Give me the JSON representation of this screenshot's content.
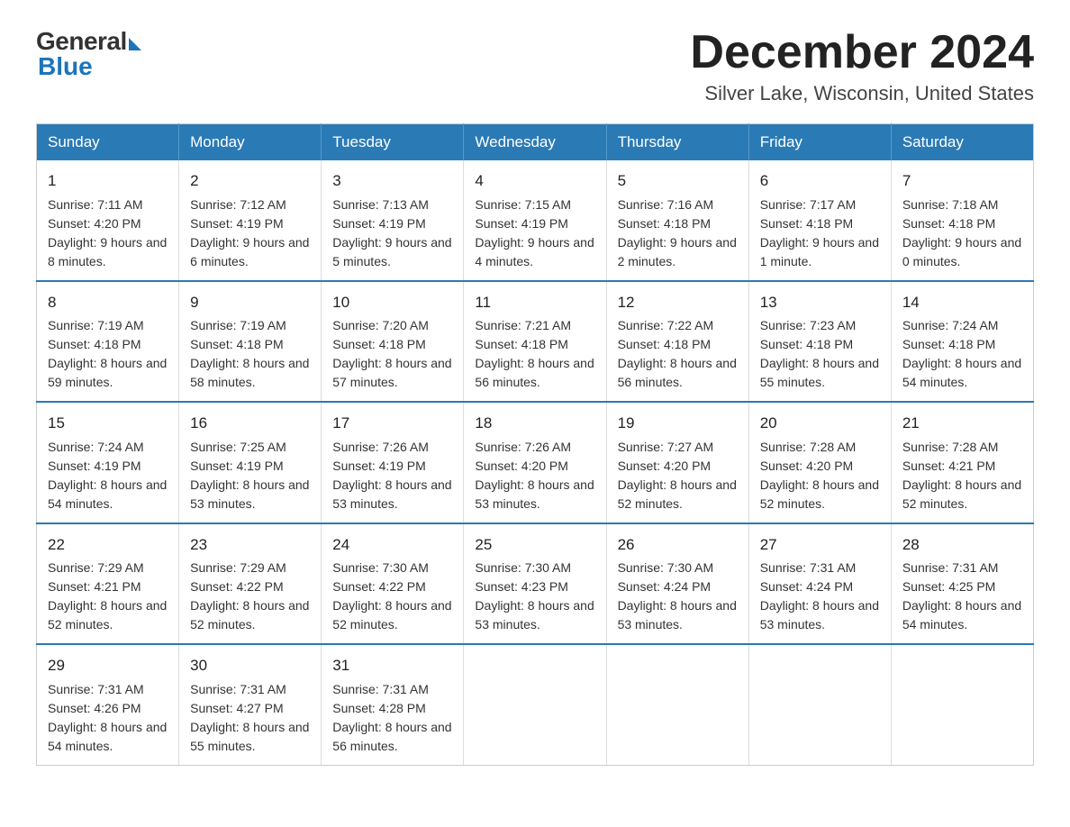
{
  "logo": {
    "general": "General",
    "blue": "Blue"
  },
  "header": {
    "month_year": "December 2024",
    "location": "Silver Lake, Wisconsin, United States"
  },
  "weekdays": [
    "Sunday",
    "Monday",
    "Tuesday",
    "Wednesday",
    "Thursday",
    "Friday",
    "Saturday"
  ],
  "weeks": [
    [
      {
        "day": "1",
        "sunrise": "7:11 AM",
        "sunset": "4:20 PM",
        "daylight": "9 hours and 8 minutes."
      },
      {
        "day": "2",
        "sunrise": "7:12 AM",
        "sunset": "4:19 PM",
        "daylight": "9 hours and 6 minutes."
      },
      {
        "day": "3",
        "sunrise": "7:13 AM",
        "sunset": "4:19 PM",
        "daylight": "9 hours and 5 minutes."
      },
      {
        "day": "4",
        "sunrise": "7:15 AM",
        "sunset": "4:19 PM",
        "daylight": "9 hours and 4 minutes."
      },
      {
        "day": "5",
        "sunrise": "7:16 AM",
        "sunset": "4:18 PM",
        "daylight": "9 hours and 2 minutes."
      },
      {
        "day": "6",
        "sunrise": "7:17 AM",
        "sunset": "4:18 PM",
        "daylight": "9 hours and 1 minute."
      },
      {
        "day": "7",
        "sunrise": "7:18 AM",
        "sunset": "4:18 PM",
        "daylight": "9 hours and 0 minutes."
      }
    ],
    [
      {
        "day": "8",
        "sunrise": "7:19 AM",
        "sunset": "4:18 PM",
        "daylight": "8 hours and 59 minutes."
      },
      {
        "day": "9",
        "sunrise": "7:19 AM",
        "sunset": "4:18 PM",
        "daylight": "8 hours and 58 minutes."
      },
      {
        "day": "10",
        "sunrise": "7:20 AM",
        "sunset": "4:18 PM",
        "daylight": "8 hours and 57 minutes."
      },
      {
        "day": "11",
        "sunrise": "7:21 AM",
        "sunset": "4:18 PM",
        "daylight": "8 hours and 56 minutes."
      },
      {
        "day": "12",
        "sunrise": "7:22 AM",
        "sunset": "4:18 PM",
        "daylight": "8 hours and 56 minutes."
      },
      {
        "day": "13",
        "sunrise": "7:23 AM",
        "sunset": "4:18 PM",
        "daylight": "8 hours and 55 minutes."
      },
      {
        "day": "14",
        "sunrise": "7:24 AM",
        "sunset": "4:18 PM",
        "daylight": "8 hours and 54 minutes."
      }
    ],
    [
      {
        "day": "15",
        "sunrise": "7:24 AM",
        "sunset": "4:19 PM",
        "daylight": "8 hours and 54 minutes."
      },
      {
        "day": "16",
        "sunrise": "7:25 AM",
        "sunset": "4:19 PM",
        "daylight": "8 hours and 53 minutes."
      },
      {
        "day": "17",
        "sunrise": "7:26 AM",
        "sunset": "4:19 PM",
        "daylight": "8 hours and 53 minutes."
      },
      {
        "day": "18",
        "sunrise": "7:26 AM",
        "sunset": "4:20 PM",
        "daylight": "8 hours and 53 minutes."
      },
      {
        "day": "19",
        "sunrise": "7:27 AM",
        "sunset": "4:20 PM",
        "daylight": "8 hours and 52 minutes."
      },
      {
        "day": "20",
        "sunrise": "7:28 AM",
        "sunset": "4:20 PM",
        "daylight": "8 hours and 52 minutes."
      },
      {
        "day": "21",
        "sunrise": "7:28 AM",
        "sunset": "4:21 PM",
        "daylight": "8 hours and 52 minutes."
      }
    ],
    [
      {
        "day": "22",
        "sunrise": "7:29 AM",
        "sunset": "4:21 PM",
        "daylight": "8 hours and 52 minutes."
      },
      {
        "day": "23",
        "sunrise": "7:29 AM",
        "sunset": "4:22 PM",
        "daylight": "8 hours and 52 minutes."
      },
      {
        "day": "24",
        "sunrise": "7:30 AM",
        "sunset": "4:22 PM",
        "daylight": "8 hours and 52 minutes."
      },
      {
        "day": "25",
        "sunrise": "7:30 AM",
        "sunset": "4:23 PM",
        "daylight": "8 hours and 53 minutes."
      },
      {
        "day": "26",
        "sunrise": "7:30 AM",
        "sunset": "4:24 PM",
        "daylight": "8 hours and 53 minutes."
      },
      {
        "day": "27",
        "sunrise": "7:31 AM",
        "sunset": "4:24 PM",
        "daylight": "8 hours and 53 minutes."
      },
      {
        "day": "28",
        "sunrise": "7:31 AM",
        "sunset": "4:25 PM",
        "daylight": "8 hours and 54 minutes."
      }
    ],
    [
      {
        "day": "29",
        "sunrise": "7:31 AM",
        "sunset": "4:26 PM",
        "daylight": "8 hours and 54 minutes."
      },
      {
        "day": "30",
        "sunrise": "7:31 AM",
        "sunset": "4:27 PM",
        "daylight": "8 hours and 55 minutes."
      },
      {
        "day": "31",
        "sunrise": "7:31 AM",
        "sunset": "4:28 PM",
        "daylight": "8 hours and 56 minutes."
      },
      null,
      null,
      null,
      null
    ]
  ],
  "labels": {
    "sunrise": "Sunrise:",
    "sunset": "Sunset:",
    "daylight": "Daylight:"
  }
}
